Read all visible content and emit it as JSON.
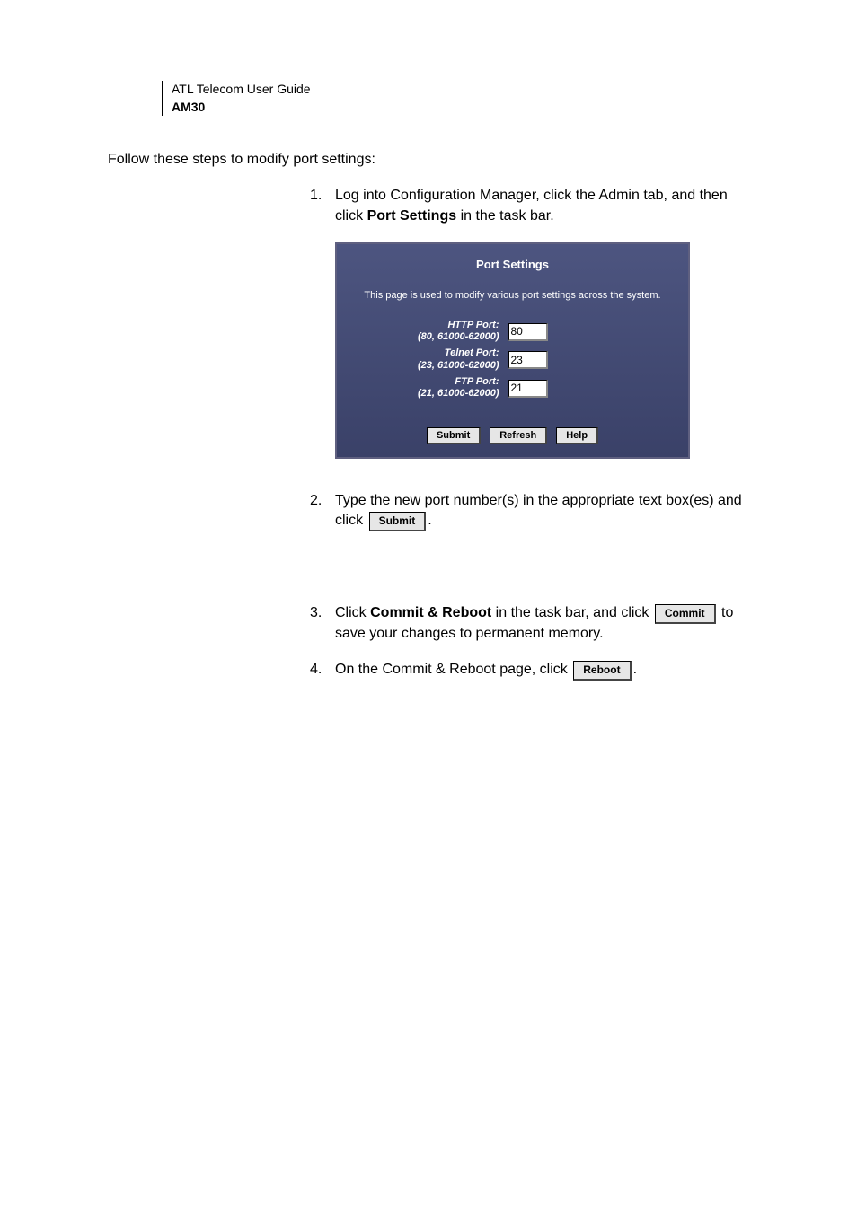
{
  "header": {
    "company": "ATL Telecom User Guide",
    "model": "AM30"
  },
  "intro": "Follow these steps to modify port settings:",
  "steps": {
    "s1": {
      "num": "1.",
      "text_a": "Log into Configuration Manager, click the Admin tab, and then click ",
      "bold": "Port Settings",
      "text_b": " in the task bar."
    },
    "s2": {
      "num": "2.",
      "text_a": "Type the new port number(s) in the appropriate text box(es) and click ",
      "btn": "Submit",
      "text_b": "."
    },
    "s3": {
      "num": "3.",
      "text_a": "Click ",
      "bold": "Commit & Reboot",
      "text_b": " in the task bar, and click ",
      "btn": "Commit",
      "text_c": " to save your changes to permanent memory."
    },
    "s4": {
      "num": "4.",
      "text_a": "On the Commit & Reboot page, click ",
      "btn": "Reboot",
      "text_b": "."
    }
  },
  "panel": {
    "title": "Port Settings",
    "desc": "This page is used to modify various port settings across the system.",
    "rows": {
      "http": {
        "label": "HTTP Port:",
        "range": "(80, 61000-62000)",
        "value": "80"
      },
      "telnet": {
        "label": "Telnet Port:",
        "range": "(23, 61000-62000)",
        "value": "23"
      },
      "ftp": {
        "label": "FTP Port:",
        "range": "(21, 61000-62000)",
        "value": "21"
      }
    },
    "buttons": {
      "submit": "Submit",
      "refresh": "Refresh",
      "help": "Help"
    }
  }
}
